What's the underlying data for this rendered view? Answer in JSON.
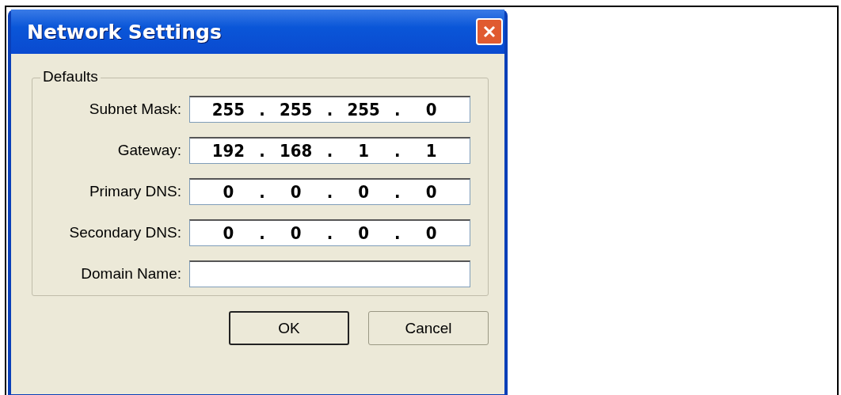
{
  "window": {
    "title": "Network Settings"
  },
  "group": {
    "title": "Defaults"
  },
  "fields": [
    {
      "label": "Subnet Mask:",
      "kind": "ip",
      "octets": [
        "255",
        "255",
        "255",
        "0"
      ],
      "separator": "."
    },
    {
      "label": "Gateway:",
      "kind": "ip",
      "octets": [
        "192",
        "168",
        "1",
        "1"
      ],
      "separator": "."
    },
    {
      "label": "Primary DNS:",
      "kind": "ip",
      "octets": [
        "0",
        "0",
        "0",
        "0"
      ],
      "separator": "."
    },
    {
      "label": "Secondary DNS:",
      "kind": "ip",
      "octets": [
        "0",
        "0",
        "0",
        "0"
      ],
      "separator": "."
    },
    {
      "label": "Domain Name:",
      "kind": "text"
    }
  ],
  "buttons": [
    {
      "label": "OK",
      "default": true
    },
    {
      "label": "Cancel",
      "default": false
    }
  ]
}
